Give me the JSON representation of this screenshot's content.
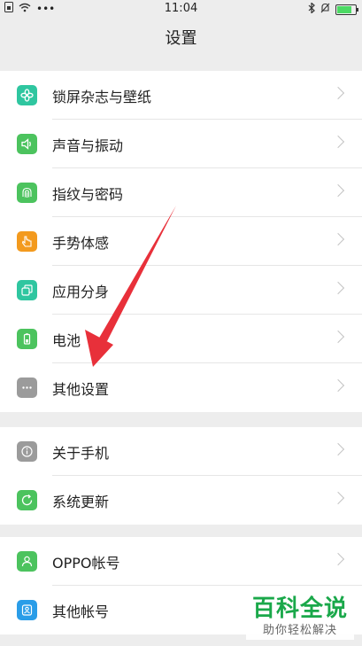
{
  "status_bar": {
    "time": "11:04",
    "left_icons": [
      "sim-icon",
      "wifi-icon",
      "more-dots-icon"
    ],
    "right_icons": [
      "bluetooth-icon",
      "mute-icon",
      "battery-icon"
    ],
    "battery_level": 0.8
  },
  "header": {
    "title": "设置"
  },
  "groups": [
    {
      "items": [
        {
          "label": "锁屏杂志与壁纸",
          "icon": "flower-icon",
          "color": "#2fc6a0"
        },
        {
          "label": "声音与振动",
          "icon": "speaker-icon",
          "color": "#4cc35e"
        },
        {
          "label": "指纹与密码",
          "icon": "fingerprint-icon",
          "color": "#4cc35e"
        },
        {
          "label": "手势体感",
          "icon": "hand-icon",
          "color": "#f39a1e"
        },
        {
          "label": "应用分身",
          "icon": "clone-icon",
          "color": "#2fc6a0"
        },
        {
          "label": "电池",
          "icon": "battery-icon",
          "color": "#4cc35e"
        },
        {
          "label": "其他设置",
          "icon": "more-icon",
          "color": "#9b9b9b"
        }
      ]
    },
    {
      "items": [
        {
          "label": "关于手机",
          "icon": "info-icon",
          "color": "#9b9b9b"
        },
        {
          "label": "系统更新",
          "icon": "update-icon",
          "color": "#4cc35e"
        }
      ]
    },
    {
      "items": [
        {
          "label": "OPPO帐号",
          "icon": "user-icon",
          "color": "#4cc35e"
        },
        {
          "label": "其他帐号",
          "icon": "account-icon",
          "color": "#2a9de8"
        }
      ]
    }
  ],
  "annotation": {
    "arrow_color": "#e8303a"
  },
  "watermark": {
    "title": "百科全说",
    "subtitle": "助你轻松解决"
  }
}
